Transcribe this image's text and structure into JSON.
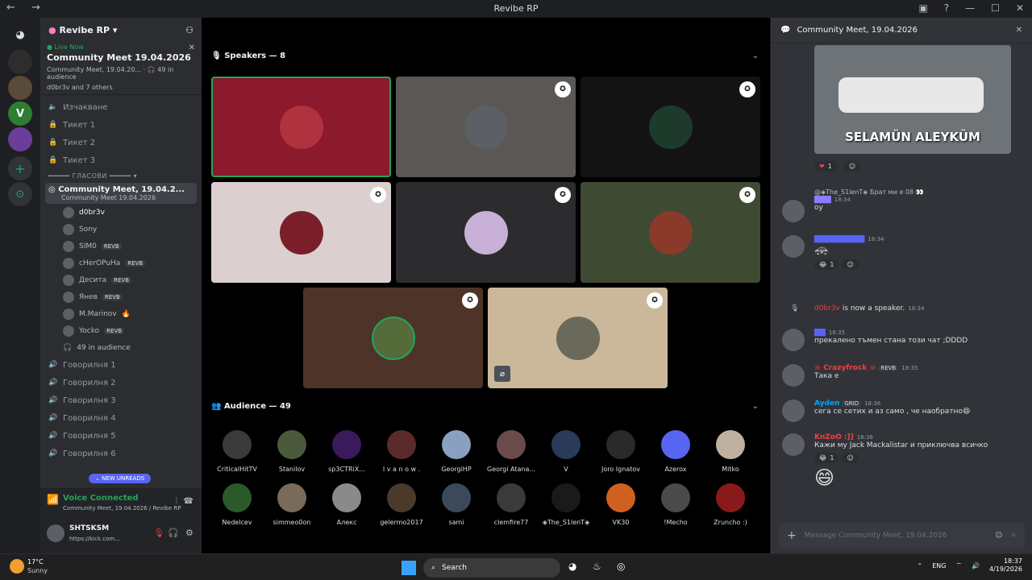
{
  "window": {
    "title": "Revibe RP",
    "nav": "← →"
  },
  "server": {
    "name": "Revibe RP"
  },
  "live": {
    "tag": "Live Now",
    "title": "Community Meet 19.04.2026",
    "sub": "Community Meet, 19.04.20...",
    "audience": "49 in audience",
    "members": "d0br3v and 7 others"
  },
  "channels": [
    {
      "name": "Изчакване",
      "icon": "speaker-icon"
    },
    {
      "name": "Тикет 1",
      "icon": "lock-icon"
    },
    {
      "name": "Тикет 2",
      "icon": "lock-icon"
    },
    {
      "name": "Тикет 3",
      "icon": "lock-icon"
    }
  ],
  "category": "ГЛАСОВИ",
  "stage_channel": {
    "name": "Community Meet, 19.04.2...",
    "sub": "Community Meet 19.04.2026"
  },
  "members": [
    {
      "name": "d0br3v",
      "badge": ""
    },
    {
      "name": "Sony",
      "badge": ""
    },
    {
      "name": "SIM0",
      "badge": "REVB"
    },
    {
      "name": "cHerOPuHa",
      "badge": "REVB"
    },
    {
      "name": "Десита",
      "badge": "REVB"
    },
    {
      "name": "Янев",
      "badge": "REVB"
    },
    {
      "name": "M.Marinov",
      "badge": ""
    },
    {
      "name": "Yocko",
      "badge": "REVB"
    }
  ],
  "audience_count": "49 in audience",
  "voice_channels": [
    "Говорилня 1",
    "Говорилня 2",
    "Говорилня 3",
    "Говорилня 4",
    "Говорилня 5",
    "Говорилня 6"
  ],
  "new_unreads": "NEW UNREADS",
  "voice": {
    "status": "Voice Connected",
    "channel": "Community Meet, 19.04.2026 / Revibe RP"
  },
  "user": {
    "name": "SHTSKSM",
    "status": "https://kick.com..."
  },
  "stage": {
    "speakers_label": "Speakers — 8",
    "audience_label": "Audience — 49"
  },
  "audience": [
    {
      "name": "CriticalHitTV"
    },
    {
      "name": "Stanilov"
    },
    {
      "name": "sp3CTRiX..."
    },
    {
      "name": "I v a n o w ."
    },
    {
      "name": "GeorgiHP"
    },
    {
      "name": "Georgi Atana..."
    },
    {
      "name": "V"
    },
    {
      "name": "Joro Ignatov"
    },
    {
      "name": "Azerox"
    },
    {
      "name": "Mitko"
    },
    {
      "name": "Nedelcev"
    },
    {
      "name": "simmeo0on"
    },
    {
      "name": "Алекс"
    },
    {
      "name": "gelermo2017"
    },
    {
      "name": "sami"
    },
    {
      "name": "clemfire77"
    },
    {
      "name": "◈The_S1lenT◈"
    },
    {
      "name": "VK30"
    },
    {
      "name": "!Mecho"
    },
    {
      "name": "Zruncho :)"
    }
  ],
  "chat": {
    "title": "Community Meet, 19.04.2026",
    "image_caption": "SELAMÜN ALEYKÜM",
    "r1": {
      "emoji": "❤",
      "count": "1"
    },
    "reply": "@◈The_S1lenT◈ Брат ми е 08 👀",
    "m1": {
      "time": "18:34",
      "text": "оу"
    },
    "m2": {
      "time": "18:34",
      "text": "🚓"
    },
    "r2": {
      "emoji": "😂",
      "count": "1"
    },
    "sys": {
      "user": "d0br3v",
      "text": "is now a speaker.",
      "time": "18:34"
    },
    "m3": {
      "time": "18:35",
      "text": "прекалено тъмен стана този чат ;DDDD"
    },
    "m4": {
      "user": "☠ Crazyfrock ☠",
      "badge": "REVB",
      "time": "18:35",
      "text": "Така е"
    },
    "m5": {
      "user": "Ayden",
      "badge": "GRID",
      "time": "18:36",
      "text": "сега се сетих и аз само , че наобратно😄"
    },
    "m6": {
      "user": "KnZoO :]]",
      "time": "18:36",
      "text": "Кажи му Jack Mackalistar и приключва всичко"
    },
    "r3": {
      "emoji": "😂",
      "count": "1"
    },
    "big_emoji": "😄",
    "placeholder": "Message Community Meet, 19.04.2026"
  },
  "taskbar": {
    "temp": "17°C",
    "weather": "Sunny",
    "search": "Search",
    "lang": "ENG",
    "time": "18:37",
    "date": "4/19/2026"
  },
  "colors": {
    "accent": "#5865f2",
    "green": "#23a55a"
  }
}
